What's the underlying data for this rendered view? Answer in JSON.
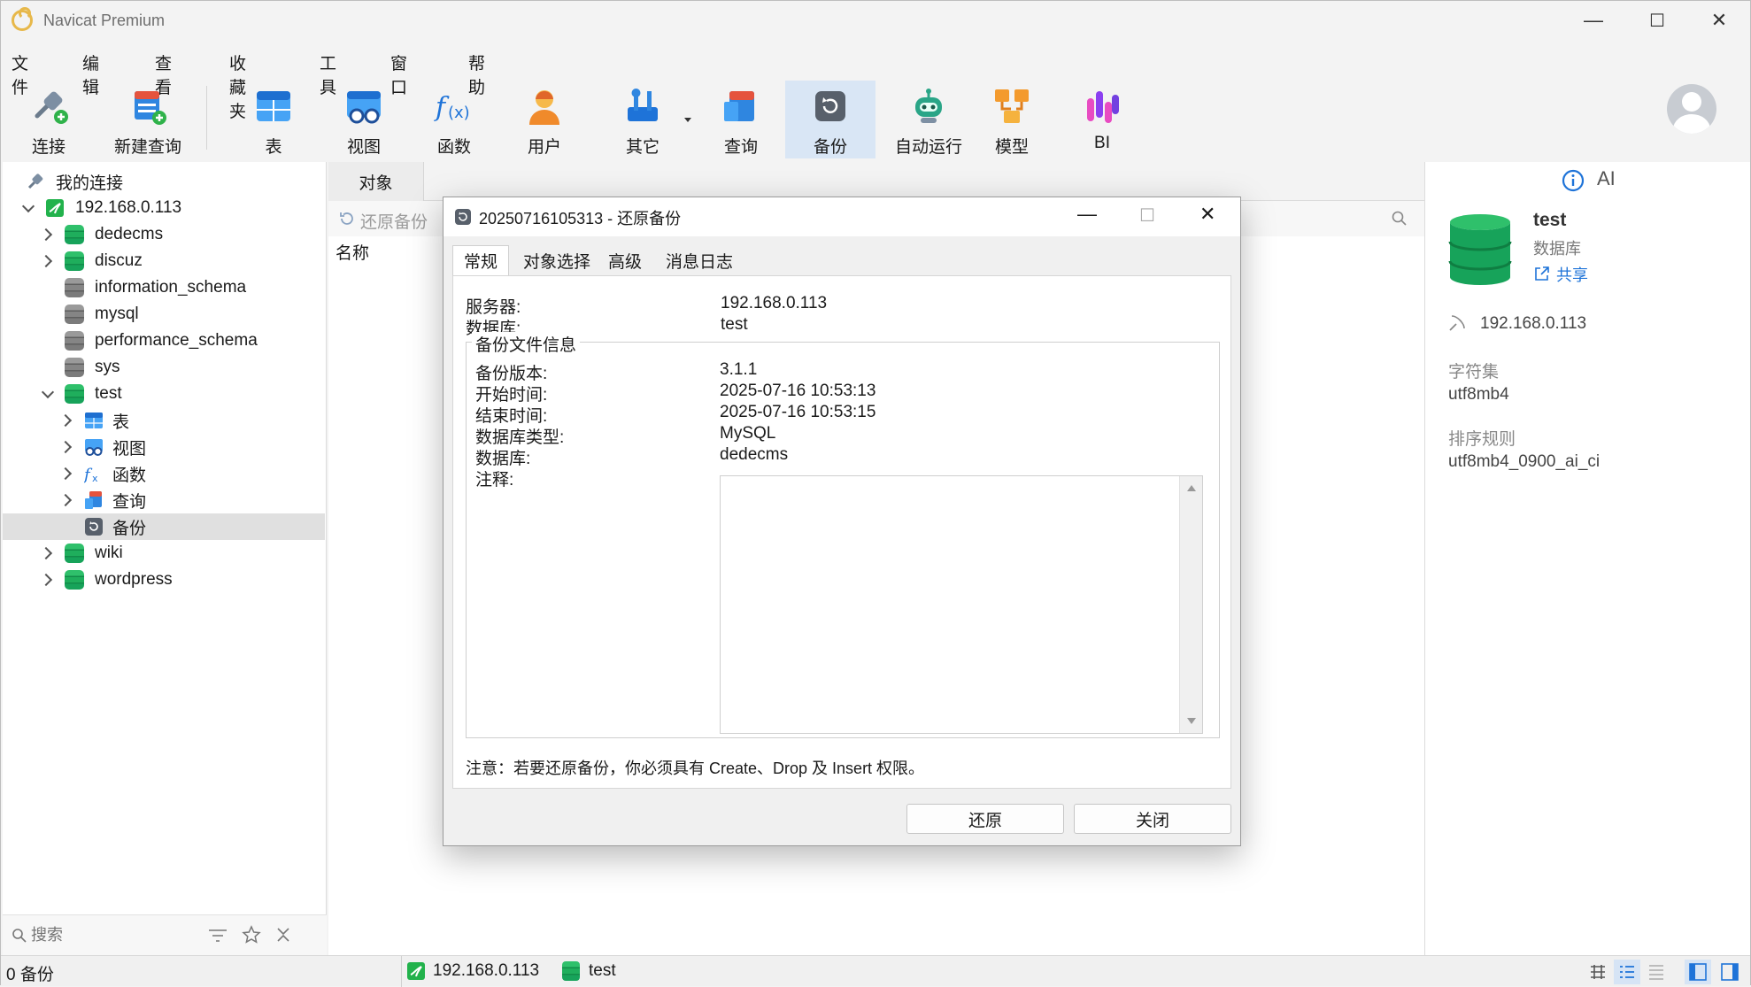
{
  "app": {
    "title": "Navicat Premium"
  },
  "window_controls": {
    "minimize": "—",
    "maximize": "☐",
    "close": "✕"
  },
  "menu": [
    "文件",
    "编辑",
    "查看",
    "收藏夹",
    "工具",
    "窗口",
    "帮助"
  ],
  "toolbar": {
    "connect": "连接",
    "new_query": "新建查询",
    "table": "表",
    "view": "视图",
    "function": "函数",
    "user": "用户",
    "other": "其它",
    "query": "查询",
    "backup": "备份",
    "automation": "自动运行",
    "model": "模型",
    "bi": "BI"
  },
  "tree": {
    "root": "我的连接",
    "connection": "192.168.0.113",
    "databases": [
      "dedecms",
      "discuz",
      "information_schema",
      "mysql",
      "performance_schema",
      "sys",
      "test"
    ],
    "test_children": [
      "表",
      "视图",
      "函数",
      "查询",
      "备份"
    ],
    "after": [
      "wiki",
      "wordpress"
    ]
  },
  "search": {
    "placeholder": "搜索"
  },
  "object_pane": {
    "tab": "对象",
    "toolbar_restore": "还原备份",
    "column_name": "名称"
  },
  "info_panel": {
    "ai_label": "AI",
    "db_name": "test",
    "db_type": "数据库",
    "share": "共享",
    "host": "192.168.0.113",
    "charset_label": "字符集",
    "charset_value": "utf8mb4",
    "collation_label": "排序规则",
    "collation_value": "utf8mb4_0900_ai_ci"
  },
  "statusbar": {
    "left": "0 备份",
    "connection": "192.168.0.113",
    "database": "test"
  },
  "dialog": {
    "title": "20250716105313 - 还原备份",
    "tabs": [
      "常规",
      "对象选择",
      "高级",
      "消息日志"
    ],
    "server_label": "服务器:",
    "server_value": "192.168.0.113",
    "database_label": "数据库:",
    "database_value": "test",
    "group_title": "备份文件信息",
    "info": [
      {
        "key": "备份版本:",
        "value": "3.1.1"
      },
      {
        "key": "开始时间:",
        "value": "2025-07-16 10:53:13"
      },
      {
        "key": "结束时间:",
        "value": "2025-07-16 10:53:15"
      },
      {
        "key": "数据库类型:",
        "value": "MySQL"
      },
      {
        "key": "数据库:",
        "value": "dedecms"
      }
    ],
    "notes_label": "注释:",
    "note": "注意：若要还原备份，你必须具有 Create、Drop 及 Insert 权限。",
    "restore_button": "还原",
    "close_button": "关闭"
  },
  "colors": {
    "accent": "#1e73d8",
    "db_green": "#17a35a",
    "db_gray": "#7b7b7b",
    "selection": "#e0e0e0"
  }
}
